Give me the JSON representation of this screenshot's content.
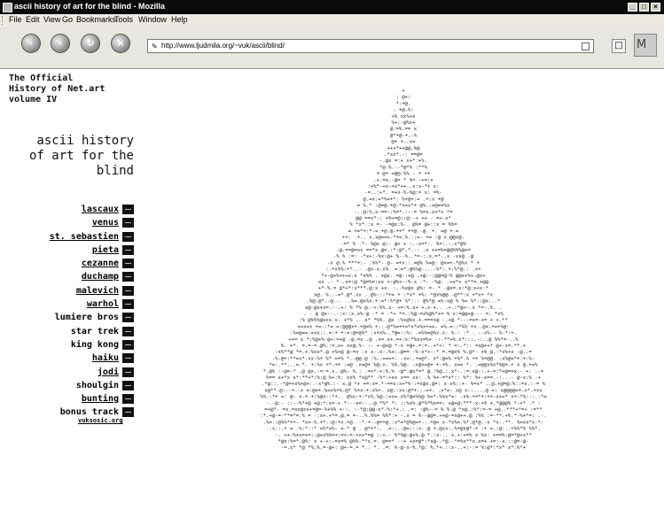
{
  "window": {
    "title": "ascii history of art for the blind - Mozilla",
    "buttons": [
      "_",
      "□",
      "×"
    ]
  },
  "menu": [
    "File",
    "Edit",
    "View",
    "Go",
    "Bookmarks",
    "Tools",
    "Window",
    "Help"
  ],
  "navigation": {
    "back_icon": "‹",
    "forward_icon": "›",
    "reload_icon": "↻",
    "stop_icon": "×",
    "url": "http://www.ljudmila.org/~vuk/ascii/blind/",
    "site_icon": "✎",
    "logo_icon": "M"
  },
  "page": {
    "heading": [
      "The Official",
      "History of Net.art",
      "volume IV"
    ],
    "art_title": [
      "ascii history",
      "of art for the",
      "blind"
    ],
    "links": [
      {
        "label": "lascaux",
        "link": true
      },
      {
        "label": "venus",
        "link": true
      },
      {
        "label": "st. sebastien",
        "link": true
      },
      {
        "label": "pieta",
        "link": true
      },
      {
        "label": "cezanne",
        "link": true
      },
      {
        "label": "duchamp",
        "link": true
      },
      {
        "label": "malevich",
        "link": true
      },
      {
        "label": "warhol",
        "link": true
      },
      {
        "label": "lumiere bros",
        "link": false
      },
      {
        "label": "star trek",
        "link": false
      },
      {
        "label": "king kong",
        "link": false
      },
      {
        "label": "haiku",
        "link": true
      },
      {
        "label": "jodi",
        "link": true
      },
      {
        "label": "shoulgin",
        "link": false
      },
      {
        "label": "bunting",
        "link": true
      },
      {
        "label": "bonus track",
        "link": false
      }
    ],
    "credit": "vuksosic.org",
    "artwork": "ascii-art-pieta"
  }
}
